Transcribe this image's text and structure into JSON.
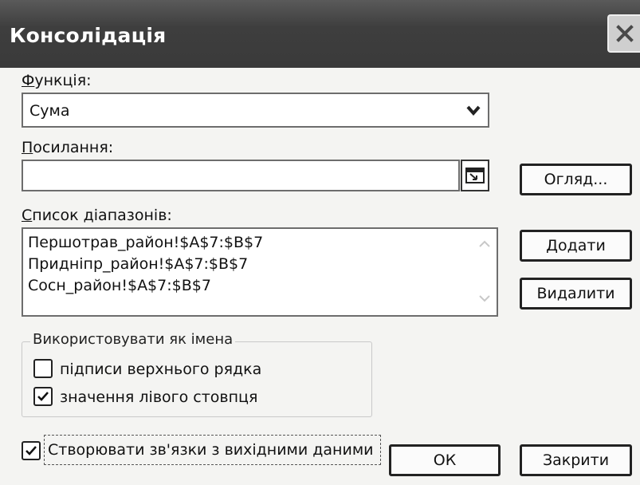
{
  "window": {
    "title": "Консолідація",
    "close_icon": "close-icon"
  },
  "function": {
    "label": "Функція:",
    "value": "Сума"
  },
  "reference": {
    "label": "Посилання:",
    "value": "",
    "browse_label": "Огляд..."
  },
  "ranges": {
    "label": "Список діапазонів:",
    "items": [
      "Першотрав_район!$A$7:$B$7",
      "Придніпр_район!$A$7:$B$7",
      "Сосн_район!$A$7:$B$7"
    ],
    "add_label": "Додати",
    "delete_label": "Видалити"
  },
  "use_labels": {
    "title": "Використовувати як імена",
    "top_row": {
      "label": "підписи верхнього рядка",
      "checked": false
    },
    "left_column": {
      "label": "значення лівого стовпця",
      "checked": true
    }
  },
  "create_links": {
    "label": "Створювати зв'язки з вихідними даними",
    "checked": true
  },
  "buttons": {
    "ok_label": "ОК",
    "close_label": "Закрити"
  }
}
